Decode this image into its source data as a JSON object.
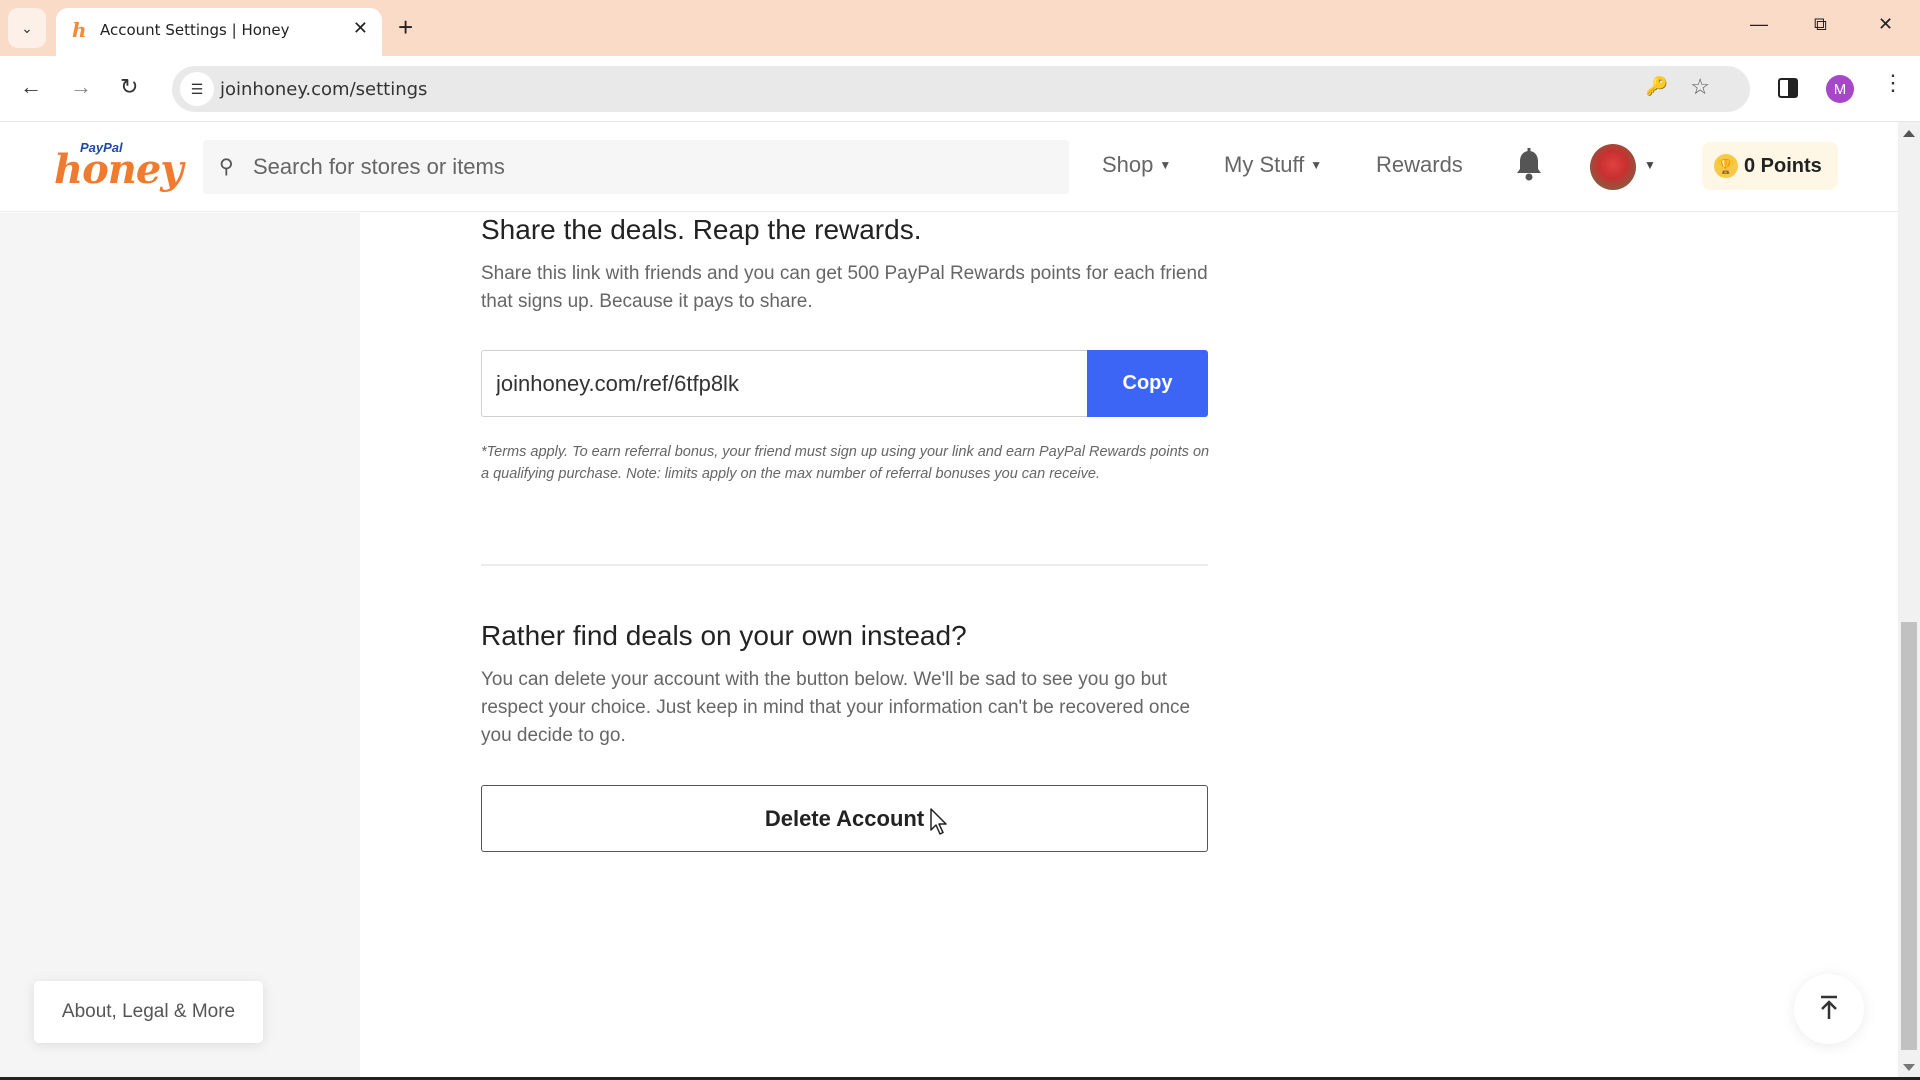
{
  "browser": {
    "tab_title": "Account Settings | Honey",
    "url": "joinhoney.com/settings",
    "profile_initial": "M",
    "icons": {
      "tab_search": "chevron-down-icon",
      "tab_favicon": "honey-h-icon",
      "tab_close": "close-icon",
      "new_tab": "plus-icon",
      "minimize": "minimize-icon",
      "restore": "restore-icon",
      "close_window": "close-icon",
      "back": "arrow-left-icon",
      "forward": "arrow-right-icon",
      "reload": "reload-icon",
      "site_info": "tune-icon",
      "password": "key-icon",
      "bookmark": "star-icon",
      "side_panel": "side-panel-icon",
      "menu": "more-vertical-icon"
    }
  },
  "header": {
    "logo_paypal": "PayPal",
    "logo_honey": "honey",
    "search_placeholder": "Search for stores or items",
    "nav": [
      {
        "label": "Shop",
        "has_dropdown": true
      },
      {
        "label": "My Stuff",
        "has_dropdown": true
      },
      {
        "label": "Rewards",
        "has_dropdown": false
      }
    ],
    "points_label": "0 Points"
  },
  "referral": {
    "heading": "Share the deals. Reap the rewards.",
    "description": "Share this link with friends and you can get 500 PayPal Rewards points for each friend that signs up. Because it pays to share.",
    "link_value": "joinhoney.com/ref/6tfp8lk",
    "copy_label": "Copy",
    "terms": "*Terms apply. To earn referral bonus, your friend must sign up using your link and earn PayPal Rewards points on a qualifying purchase. Note: limits apply on the max number of referral bonuses you can receive."
  },
  "delete_section": {
    "heading": "Rather find deals on your own instead?",
    "description": "You can delete your account with the button below. We'll be sad to see you go but respect your choice. Just keep in mind that your information can't be recovered once you decide to go.",
    "button_label": "Delete Account"
  },
  "footer": {
    "about_label": "About, Legal & More"
  },
  "colors": {
    "tabstrip_bg": "#fadbc8",
    "copy_button": "#3d65f5",
    "honey_orange": "#f07a2e",
    "paypal_blue": "#1f4aa8",
    "points_bg": "#fff7e6",
    "profile_purple": "#a646c8"
  }
}
